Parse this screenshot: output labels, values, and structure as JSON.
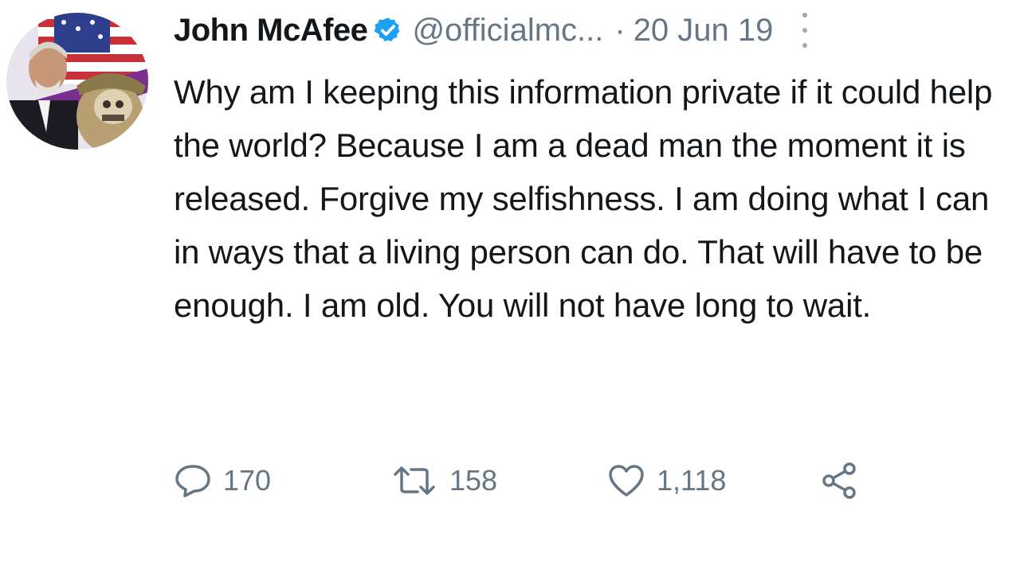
{
  "tweet": {
    "author_name": "John McAfee",
    "handle": "@officialmc...",
    "separator": "·",
    "date": "20 Jun 19",
    "text": "Why am I keeping this information private if it could help the world? Because I am a dead man the moment it is released. Forgive my selfishness. I am doing what I can in ways that a living person can do. That will have to be enough. I am old. You will not have long to wait.",
    "verified_icon": "verified-badge-icon",
    "more_icon": "more-vertical-icon"
  },
  "actions": {
    "reply_count": "170",
    "retweet_count": "158",
    "like_count": "1,118",
    "reply_icon": "reply-icon",
    "retweet_icon": "retweet-icon",
    "like_icon": "heart-icon",
    "share_icon": "share-icon"
  },
  "colors": {
    "verified_blue": "#1da1f2",
    "secondary_text": "#657786",
    "primary_text": "#14171a"
  }
}
